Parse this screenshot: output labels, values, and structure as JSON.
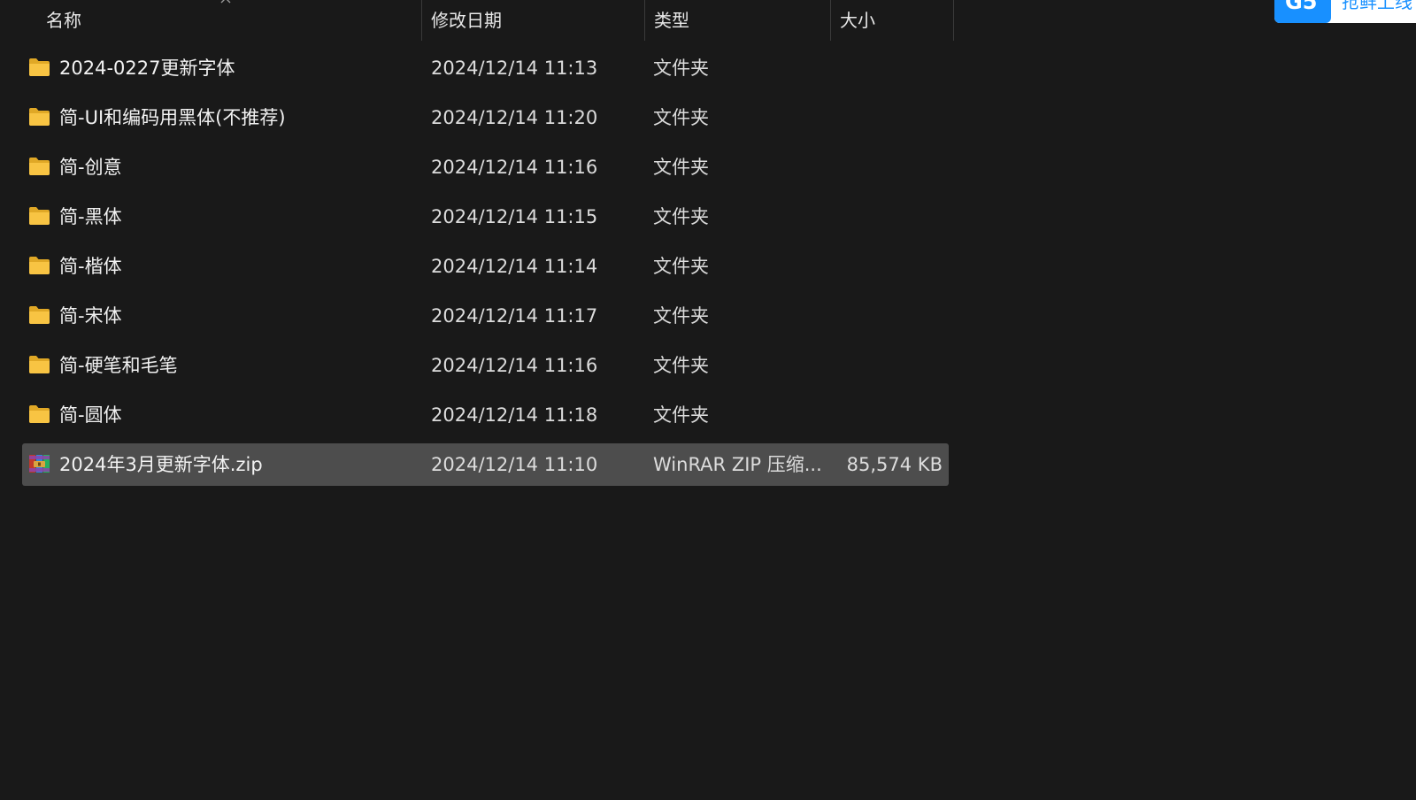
{
  "header": {
    "name": "名称",
    "date": "修改日期",
    "type": "类型",
    "size": "大小"
  },
  "files": [
    {
      "name": "2024-0227更新字体",
      "date": "2024/12/14 11:13",
      "type": "文件夹",
      "size": "",
      "icon": "folder-icon"
    },
    {
      "name": "简-UI和编码用黑体(不推荐)",
      "date": "2024/12/14 11:20",
      "type": "文件夹",
      "size": "",
      "icon": "folder-icon"
    },
    {
      "name": "简-创意",
      "date": "2024/12/14 11:16",
      "type": "文件夹",
      "size": "",
      "icon": "folder-icon"
    },
    {
      "name": "简-黑体",
      "date": "2024/12/14 11:15",
      "type": "文件夹",
      "size": "",
      "icon": "folder-icon"
    },
    {
      "name": "简-楷体",
      "date": "2024/12/14 11:14",
      "type": "文件夹",
      "size": "",
      "icon": "folder-icon"
    },
    {
      "name": "简-宋体",
      "date": "2024/12/14 11:17",
      "type": "文件夹",
      "size": "",
      "icon": "folder-icon"
    },
    {
      "name": "简-硬笔和毛笔",
      "date": "2024/12/14 11:16",
      "type": "文件夹",
      "size": "",
      "icon": "folder-icon"
    },
    {
      "name": "简-圆体",
      "date": "2024/12/14 11:18",
      "type": "文件夹",
      "size": "",
      "icon": "folder-icon"
    },
    {
      "name": "2024年3月更新字体.zip",
      "date": "2024/12/14 11:10",
      "type": "WinRAR ZIP 压缩...",
      "size": "85,574 KB",
      "icon": "winrar-archive-icon",
      "selected": true
    }
  ],
  "corner_widget": {
    "logo_text": "G5",
    "label": "抢鲜上线"
  },
  "colors": {
    "background": "#191919",
    "selected_row": "#4d4d4d",
    "folder": "#f8c443",
    "accent": "#1890ff"
  }
}
